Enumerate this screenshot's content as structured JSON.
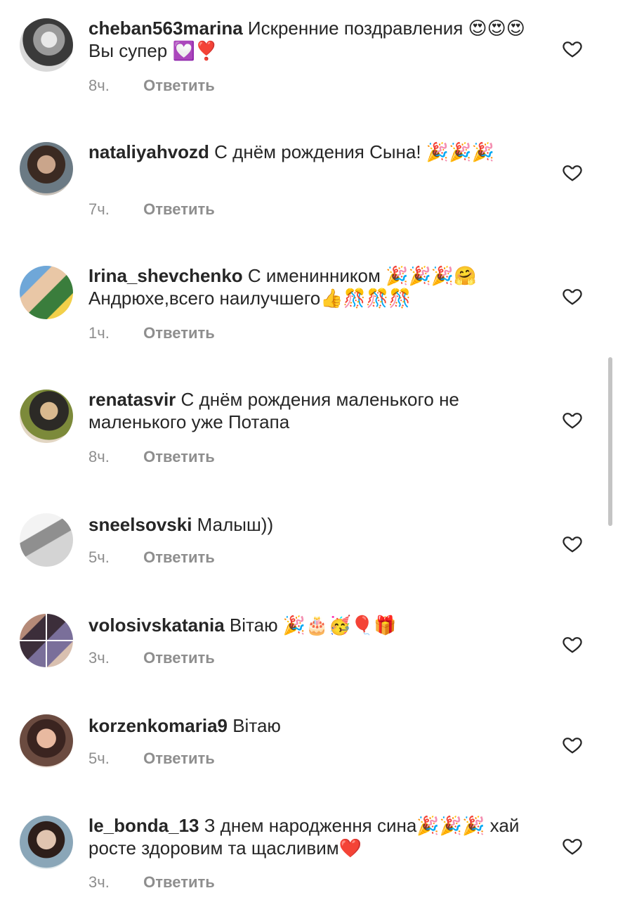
{
  "comments": [
    {
      "username": "cheban563marina",
      "text": "Искренние поздравления 😍😍😍Вы супер 💟❣️",
      "time": "8ч.",
      "reply": "Ответить"
    },
    {
      "username": "nataliyahvozd",
      "text": "С днём рождения Сына! 🎉🎉🎉",
      "time": "7ч.",
      "reply": "Ответить"
    },
    {
      "username": "Irina_shevchenko",
      "text": "С именинником 🎉🎉🎉🤗Андрюхе,всего наилучшего👍🎊🎊🎊",
      "time": "1ч.",
      "reply": "Ответить"
    },
    {
      "username": "renatasvir",
      "text": "С днём рождения маленького не маленького уже Потапа",
      "time": "8ч.",
      "reply": "Ответить"
    },
    {
      "username": "sneelsovski",
      "text": "Малыш))",
      "time": "5ч.",
      "reply": "Ответить"
    },
    {
      "username": "volosivskatania",
      "text": "Вітаю 🎉🎂🥳🎈🎁",
      "time": "3ч.",
      "reply": "Ответить"
    },
    {
      "username": "korzenkomaria9",
      "text": "Вітаю",
      "time": "5ч.",
      "reply": "Ответить"
    },
    {
      "username": "le_bonda_13",
      "text": "З днем народження сина🎉🎉🎉 хай росте здоровим та щасливим❤️",
      "time": "3ч.",
      "reply": "Ответить"
    }
  ],
  "icons": {
    "like": "heart-outline-icon",
    "avatar": "user-avatar"
  },
  "colors": {
    "text": "#262626",
    "meta": "#8e8e8e"
  }
}
